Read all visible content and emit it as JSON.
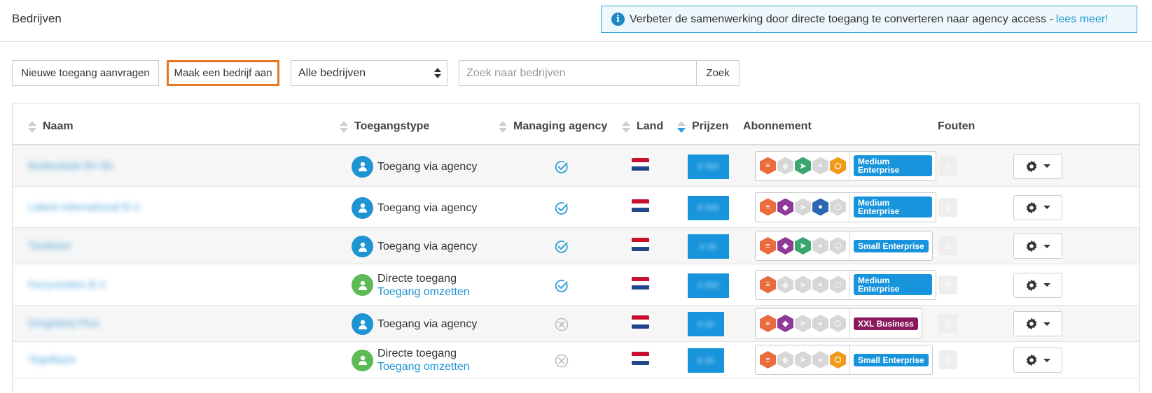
{
  "header": {
    "title": "Bedrijven",
    "info_text": "Verbeter de samenwerking door directe toegang te converteren naar agency access -",
    "info_link": "lees meer!"
  },
  "toolbar": {
    "request_label": "Nieuwe toegang aanvragen",
    "create_label": "Maak een bedrijf aan",
    "filter_value": "Alle bedrijven",
    "search_placeholder": "Zoek naar bedrijven",
    "search_label": "Zoek"
  },
  "table": {
    "columns": {
      "name": "Naam",
      "access": "Toegangstype",
      "managing": "Managing agency",
      "country": "Land",
      "prices": "Prijzen",
      "subscription": "Abonnement",
      "errors": "Fouten"
    },
    "rows": [
      {
        "name": "Bodemlade BV 80",
        "access_type": "agency",
        "access_text": "Toegang via agency",
        "access_link": "",
        "managing": "yes",
        "price": "€ 000",
        "modules": [
          true,
          false,
          true,
          false,
          true
        ],
        "plan": "Medium Enterprise",
        "plan_color": "#1794dc",
        "errors": "0"
      },
      {
        "name": "Labels International B.V.",
        "access_type": "agency",
        "access_text": "Toegang via agency",
        "access_link": "",
        "managing": "yes",
        "price": "€ 000",
        "modules": [
          true,
          true,
          false,
          true,
          false
        ],
        "plan": "Medium Enterprise",
        "plan_color": "#1794dc",
        "errors": "0"
      },
      {
        "name": "Tandeam",
        "access_type": "agency",
        "access_text": "Toegang via agency",
        "access_link": "",
        "managing": "yes",
        "price": "€ 00",
        "modules": [
          true,
          true,
          true,
          false,
          false
        ],
        "plan": "Small Enterprise",
        "plan_color": "#1794dc",
        "errors": "0"
      },
      {
        "name": "Ferryvonties B.V.",
        "access_type": "direct",
        "access_text": "Directe toegang",
        "access_link": "Toegang omzetten",
        "managing": "yes",
        "price": "€ 000",
        "modules": [
          true,
          false,
          false,
          false,
          false
        ],
        "plan": "Medium Enterprise",
        "plan_color": "#1794dc",
        "errors": "0"
      },
      {
        "name": "Drogisterij Plus",
        "access_type": "agency",
        "access_text": "Toegang via agency",
        "access_link": "",
        "managing": "no",
        "price": "€ 00",
        "modules": [
          true,
          true,
          false,
          false,
          false
        ],
        "plan": "XXL Business",
        "plan_color": "#8a1a5c",
        "errors": "0"
      },
      {
        "name": "Tegelbaze",
        "access_type": "direct",
        "access_text": "Directe toegang",
        "access_link": "Toegang omzetten",
        "managing": "no",
        "price": "€ 00",
        "modules": [
          true,
          false,
          false,
          false,
          true
        ],
        "plan": "Small Enterprise",
        "plan_color": "#1794dc",
        "errors": "0"
      }
    ]
  },
  "colors": {
    "accent": "#1e94d2",
    "create_border": "#e8761e",
    "direct_green": "#5dbb56",
    "flag": [
      "#c8102e",
      "#ffffff",
      "#21468b"
    ],
    "module_colors": [
      "#ec6b3c",
      "#8e3a96",
      "#3aa66e",
      "#2d67b1",
      "#f19a1a"
    ]
  }
}
